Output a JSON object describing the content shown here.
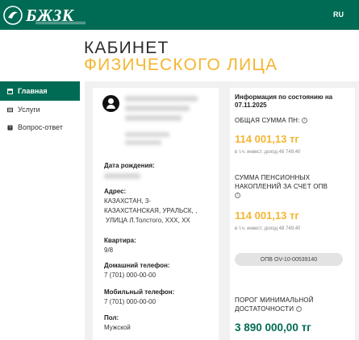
{
  "header": {
    "logo_text": "БЖЗК",
    "lang": "RU"
  },
  "page": {
    "title_line1": "КАБИНЕТ",
    "title_line2": "ФИЗИЧЕСКОГО ЛИЦА"
  },
  "sidebar": {
    "items": [
      {
        "label": "Главная",
        "icon": "home-icon",
        "active": true
      },
      {
        "label": "Услуги",
        "icon": "services-icon",
        "active": false
      },
      {
        "label": "Вопрос-ответ",
        "icon": "help-icon",
        "active": false
      }
    ]
  },
  "profile": {
    "birth_label": "Дата рождения:",
    "address_label": "Адрес:",
    "address_line1": "КАЗАХСТАН, 3-",
    "address_line2": "КАЗАХСТАНСКАЯ, УРАЛЬСК, ,",
    "address_line3": "УЛИЦА Л.Толстого, XXX, XX",
    "apartment_label": "Квартира:",
    "apartment_value": "9/8",
    "home_phone_label": "Домашний телефон:",
    "home_phone_value": "7 (701) 000-00-00",
    "mobile_phone_label": "Мобильный телефон:",
    "mobile_phone_value": "7 (701) 000-00-00",
    "gender_label": "Пол:",
    "gender_value": "Мужской"
  },
  "info": {
    "head_line1": "Информация по состоянию на",
    "head_line2": "07.11.2025",
    "total_label": "ОБЩАЯ СУММА ПН:",
    "total_amount": "114 001,13 тг",
    "total_note": "в т.ч. инвест. доход 48 749,40",
    "opv_label_line1": "СУММА ПЕНСИОННЫХ",
    "opv_label_line2": "НАКОПЛЕНИЙ ЗА СЧЕТ ОПВ",
    "opv_amount": "114 001,13 тг",
    "opv_note": "в т.ч. инвест. доход 48 749,40",
    "opv_button": "ОПВ OV-10-00539140",
    "threshold_line1": "ПОРОГ МИНИМАЛЬНОЙ",
    "threshold_line2": "ДОСТАТОЧНОСТИ",
    "threshold_amount": "3 890 000,00 тг"
  },
  "colors": {
    "brand_green": "#006b54",
    "accent_yellow": "#f4b631"
  }
}
